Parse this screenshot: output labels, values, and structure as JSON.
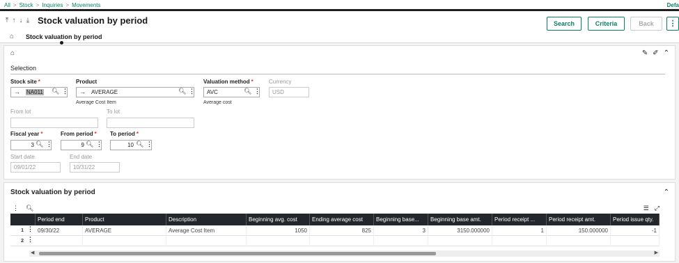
{
  "breadcrumb": [
    "All",
    "Stock",
    "Inquiries",
    "Movements"
  ],
  "top_right_text": "Defa",
  "page": {
    "title": "Stock valuation by period",
    "tab_label": "Stock valuation by period"
  },
  "toolbar": {
    "search_label": "Search",
    "criteria_label": "Criteria",
    "back_label": "Back"
  },
  "selection": {
    "section_title": "Selection",
    "stock_site": {
      "label": "Stock site",
      "value": "NA011"
    },
    "product": {
      "label": "Product",
      "value": "AVERAGE",
      "description": "Average Cost Item"
    },
    "valuation_method": {
      "label": "Valuation method",
      "value": "AVC",
      "description": "Average cost"
    },
    "currency": {
      "label": "Currency",
      "value": "USD"
    },
    "from_lot": {
      "label": "From lot",
      "value": ""
    },
    "to_lot": {
      "label": "To lot",
      "value": ""
    },
    "fiscal_year": {
      "label": "Fiscal year",
      "value": "3"
    },
    "from_period": {
      "label": "From period",
      "value": "9"
    },
    "to_period": {
      "label": "To period",
      "value": "10"
    },
    "start_date": {
      "label": "Start date",
      "value": "09/01/22"
    },
    "end_date": {
      "label": "End date",
      "value": "10/31/22"
    }
  },
  "grid": {
    "title": "Stock valuation by period",
    "columns": [
      "Period end",
      "Product",
      "Description",
      "Beginning avg. cost",
      "Ending average cost",
      "Beginning base...",
      "Beginning base amt.",
      "Period receipt ...",
      "Period receipt amt.",
      "Period issue qty."
    ],
    "rows": [
      {
        "num": "1",
        "cells": [
          "09/30/22",
          "AVERAGE",
          "Average Cost Item",
          "1050",
          "825",
          "3",
          "3150.000000",
          "1",
          "150.000000",
          "-1"
        ]
      },
      {
        "num": "2",
        "cells": [
          "",
          "",
          "",
          "",
          "",
          "",
          "",
          "",
          "",
          ""
        ]
      }
    ]
  }
}
